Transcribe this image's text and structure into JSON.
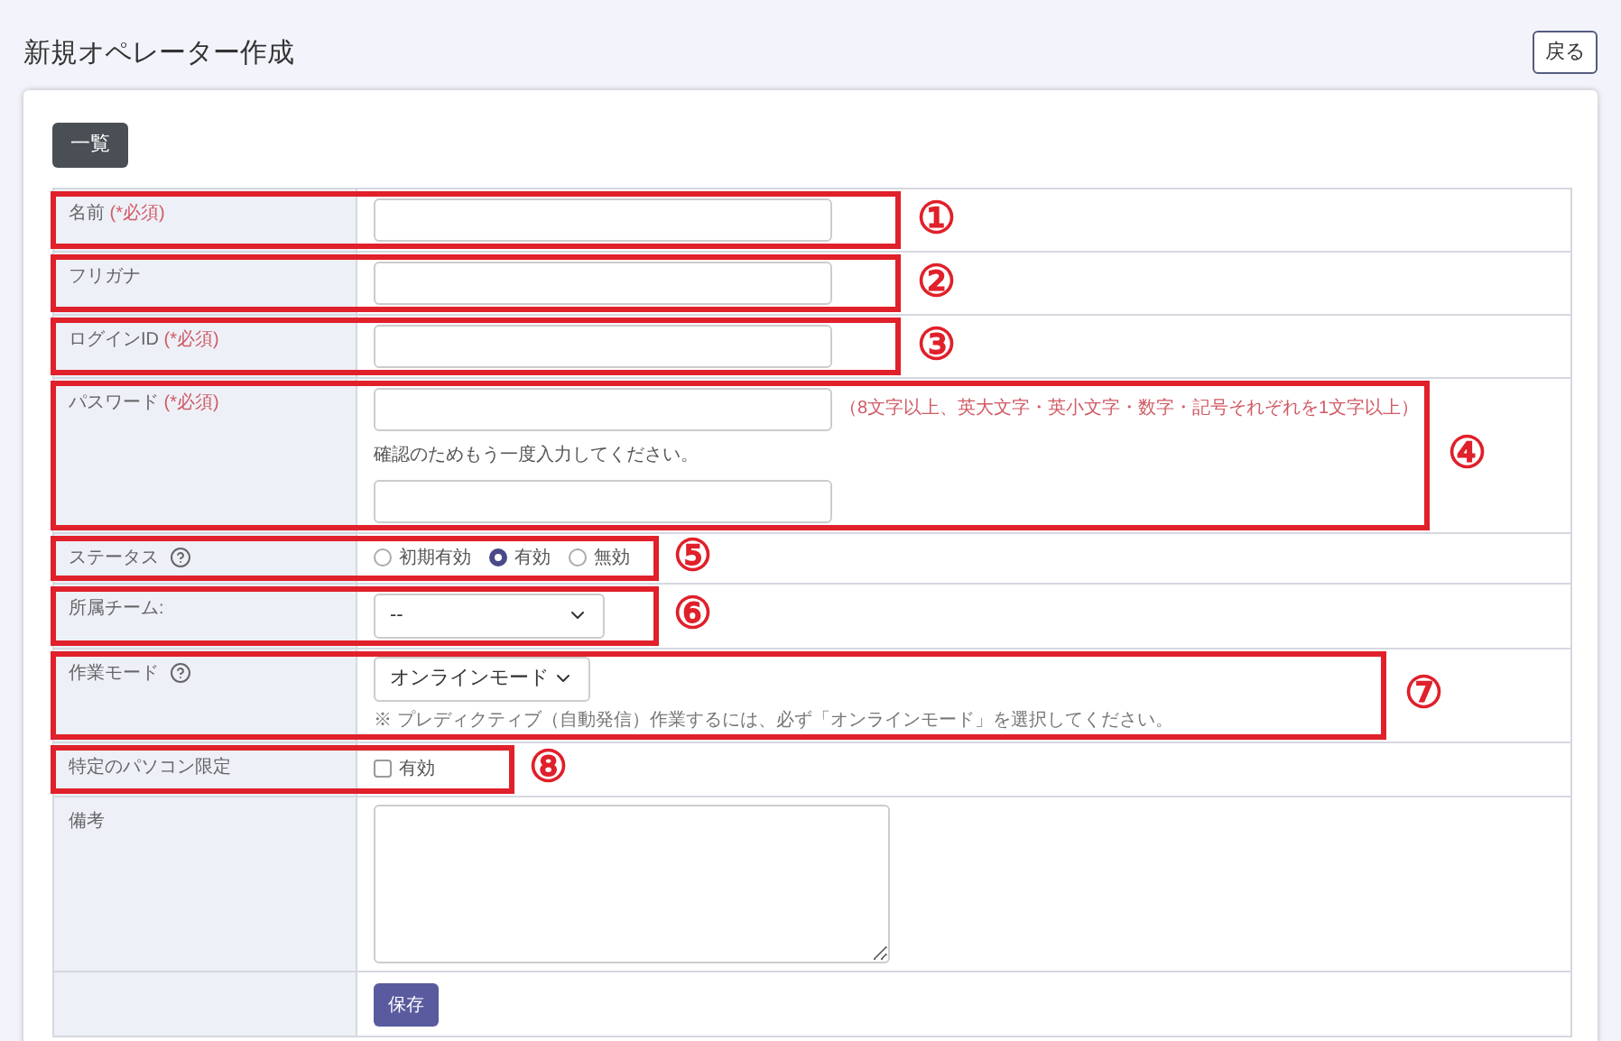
{
  "page": {
    "title": "新規オペレーター作成",
    "back_button": "戻る"
  },
  "list_button": "一覧",
  "rows": [
    {
      "kind": "text",
      "label": "名前",
      "required": "(*必須)",
      "annotation": "①"
    },
    {
      "kind": "text",
      "label": "フリガナ",
      "annotation": "②"
    },
    {
      "kind": "text",
      "label": "ログインID",
      "required": "(*必須)",
      "annotation": "③"
    },
    {
      "kind": "password",
      "label": "パスワード",
      "required": "(*必須)",
      "hint": "（8文字以上、英大文字・英小文字・数字・記号それぞれを1文字以上）",
      "confirm_text": "確認のためもう一度入力してください。",
      "annotation": "④"
    },
    {
      "kind": "radio",
      "label": "ステータス",
      "help": true,
      "options": [
        {
          "label": "初期有効",
          "selected": false
        },
        {
          "label": "有効",
          "selected": true
        },
        {
          "label": "無効",
          "selected": false
        }
      ],
      "annotation": "⑤"
    },
    {
      "kind": "select",
      "label": "所属チーム:",
      "value": "--",
      "annotation": "⑥"
    },
    {
      "kind": "select_note",
      "label": "作業モード",
      "help": true,
      "value": "オンラインモード",
      "note": "※ プレディクティブ（自動発信）作業するには、必ず「オンラインモード」を選択してください。",
      "annotation": "⑦"
    },
    {
      "kind": "checkbox",
      "label": "特定のパソコン限定",
      "option": "有効",
      "checked": false,
      "annotation": "⑧"
    },
    {
      "kind": "textarea",
      "label": "備考"
    },
    {
      "kind": "submit",
      "button": "保存"
    }
  ]
}
